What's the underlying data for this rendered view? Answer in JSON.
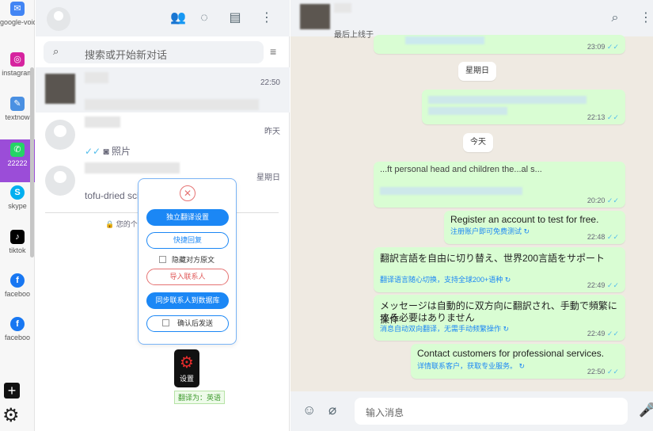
{
  "rail": {
    "apps": [
      {
        "label": "google-voice",
        "icon": "google-voice-icon",
        "color": "#4285f4",
        "glyph": "✉"
      },
      {
        "label": "instagram",
        "icon": "instagram-icon",
        "color": "#d6249f",
        "glyph": "◎"
      },
      {
        "label": "textnow",
        "icon": "textnow-icon",
        "color": "#4a90e2",
        "glyph": "💬"
      },
      {
        "label": "22222",
        "icon": "whatsapp-icon",
        "color": "#25d366",
        "glyph": "✆"
      },
      {
        "label": "skype",
        "icon": "skype-icon",
        "color": "#00aff0",
        "glyph": "S"
      },
      {
        "label": "tiktok",
        "icon": "tiktok-icon",
        "color": "#000000",
        "glyph": "♪"
      },
      {
        "label": "faceboo",
        "icon": "facebook-icon",
        "color": "#1877f2",
        "glyph": "f"
      },
      {
        "label": "faceboo",
        "icon": "facebook-icon",
        "color": "#1877f2",
        "glyph": "f"
      }
    ]
  },
  "sidebar": {
    "search_placeholder": "搜索或开始新对话",
    "chats": [
      {
        "time": "22:50",
        "preview": ""
      },
      {
        "time": "昨天",
        "preview": "照片"
      },
      {
        "time": "星期日",
        "preview": "tofu-dried sch...death s..."
      }
    ],
    "encryption_notice": "您的个人..."
  },
  "popup": {
    "independent_settings": "独立翻译设置",
    "quick_reply": "快捷回复",
    "hide_original": "隐藏对方原文",
    "import_contacts": "导入联系人",
    "sync_contacts": "同步联系人到数据库",
    "confirm_send": "确认后发送",
    "settings_label": "设置",
    "translate_to": "翻译为：英语"
  },
  "chat": {
    "last_seen": "最后上线于",
    "day_sunday": "星期日",
    "day_today": "今天",
    "input_placeholder": "输入消息",
    "messages": [
      {
        "time": "23:09"
      },
      {
        "time": "22:13"
      },
      {
        "time": "20:20",
        "text": "...ft personal head and children the...al s..."
      },
      {
        "time": "22:48",
        "text": "Register an account to test for free.",
        "trans": "注册账户即可免费测试"
      },
      {
        "time": "22:49",
        "text": "翻訳言語を自由に切り替え、世界200言語をサポート",
        "trans": "翻译语言随心切换，支持全球200+语种"
      },
      {
        "time": "22:49",
        "text": "メッセージは自動的に双方向に翻訳され、手動で頻繁に操作",
        "text2": "する必要はありません",
        "trans": "消息自动双向翻译，无需手动频繁操作"
      },
      {
        "time": "22:50",
        "text": "Contact customers for professional services.",
        "trans": "详情联系客户，获取专业服务。"
      }
    ]
  }
}
